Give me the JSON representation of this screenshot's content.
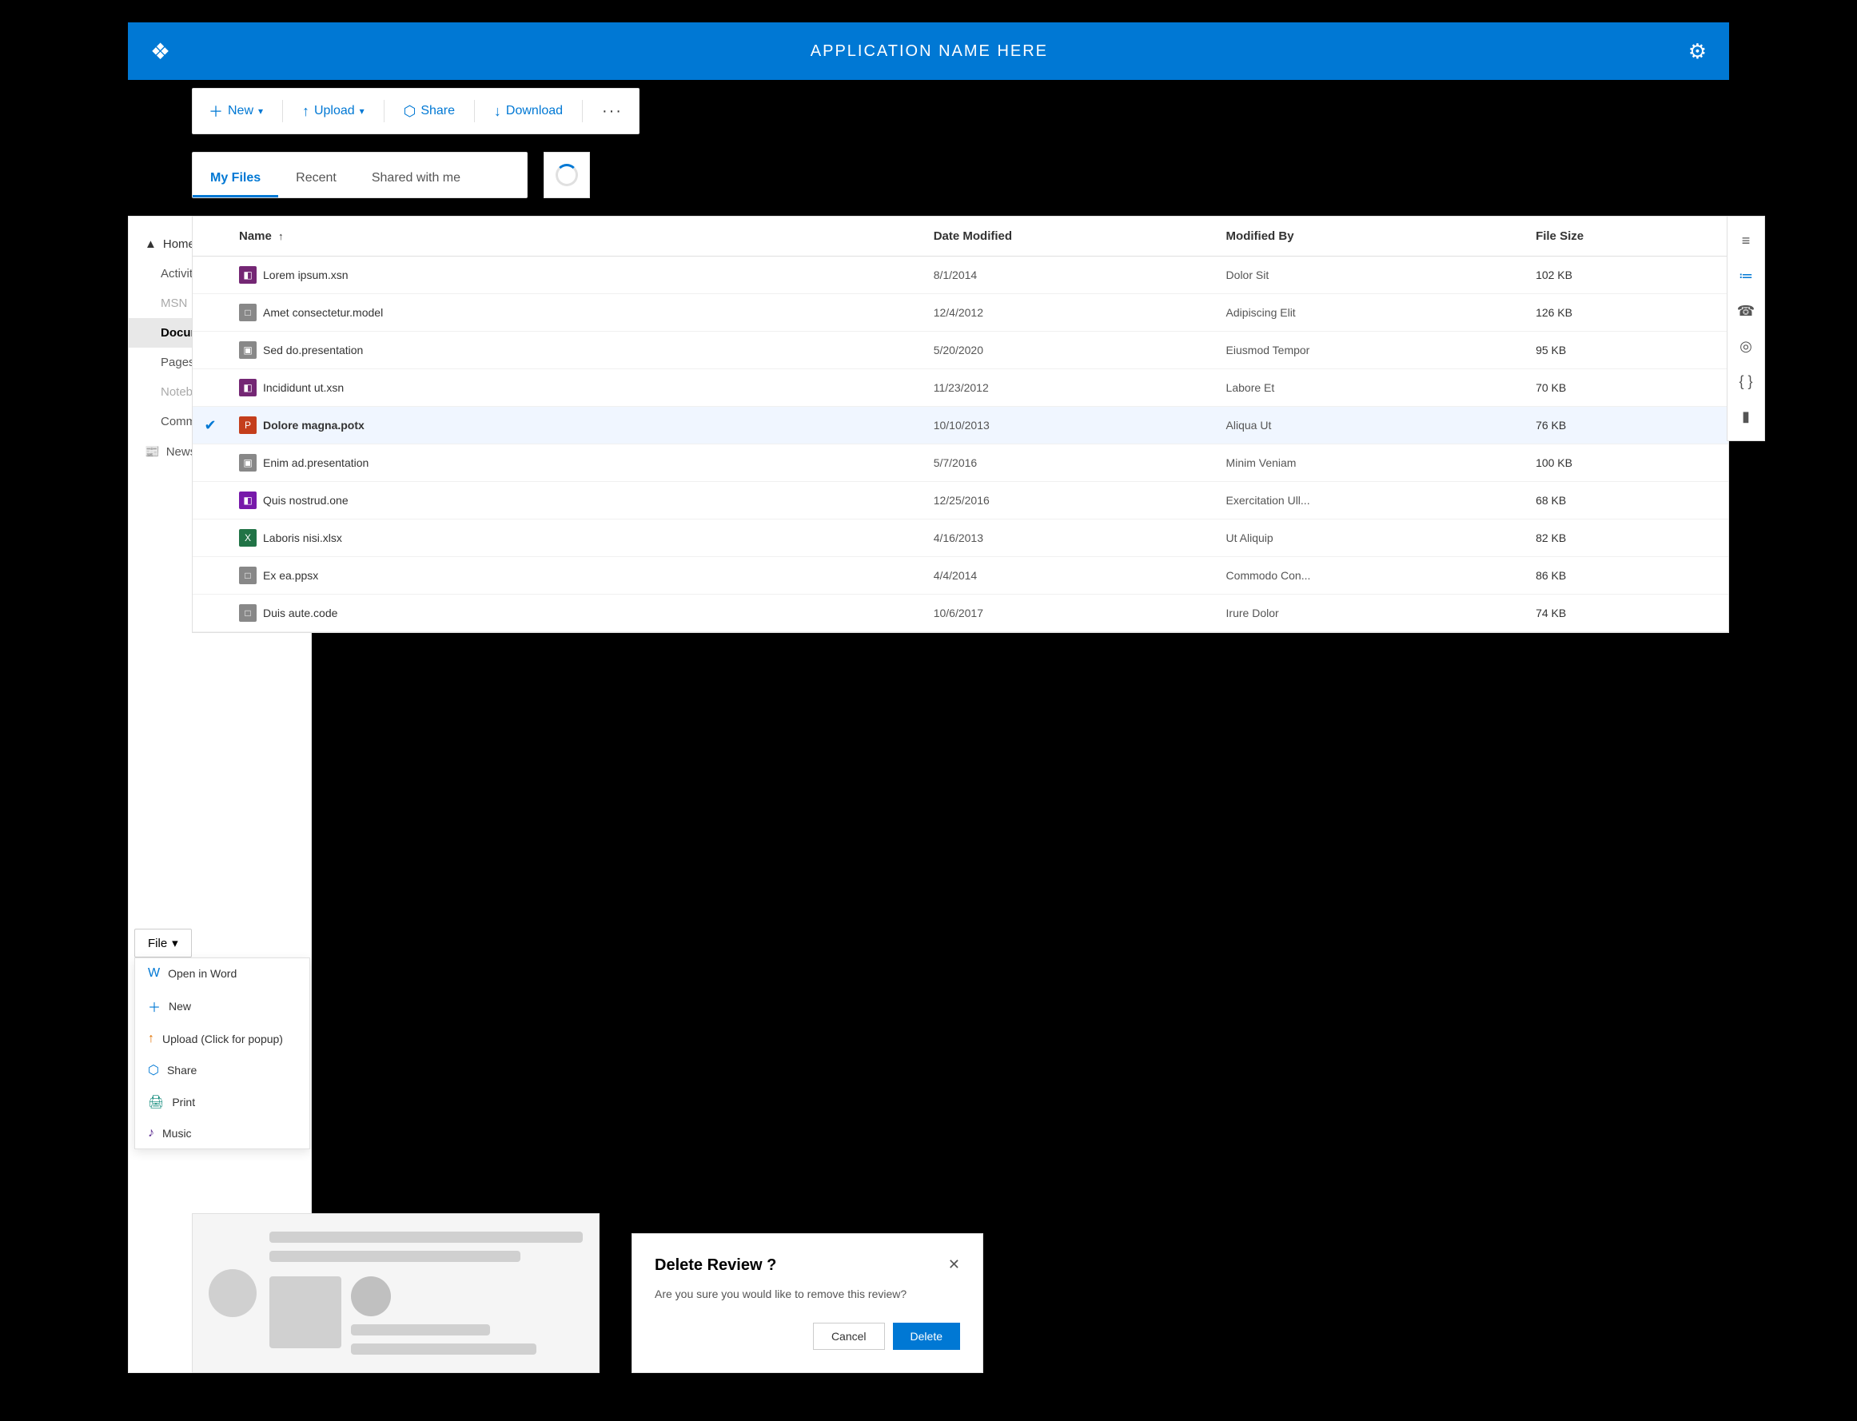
{
  "app": {
    "title": "APPLICATION NAME HERE",
    "logo_icon": "❖",
    "settings_icon": "⚙"
  },
  "toolbar": {
    "new_label": "New",
    "upload_label": "Upload",
    "share_label": "Share",
    "download_label": "Download",
    "more_icon": "···"
  },
  "tabs": {
    "my_files": "My Files",
    "recent": "Recent",
    "shared_with_me": "Shared with me"
  },
  "sidebar": {
    "home_label": "Home",
    "activity_label": "Activity",
    "msn_label": "MSN",
    "documents_label": "Documents",
    "pages_label": "Pages",
    "notebook_label": "Notebook",
    "communication_label": "Communication an...",
    "news_label": "News",
    "news_icon": "📰"
  },
  "file_dropdown": {
    "label": "File",
    "items": [
      {
        "icon": "W",
        "label": "Open in Word",
        "color": "blue"
      },
      {
        "icon": "+",
        "label": "New",
        "color": "blue2"
      },
      {
        "icon": "↑",
        "label": "Upload (Click for popup)",
        "color": "orange"
      },
      {
        "icon": "⬡",
        "label": "Share",
        "color": "blue2"
      },
      {
        "icon": "🖨",
        "label": "Print",
        "color": "teal"
      },
      {
        "icon": "♪",
        "label": "Music",
        "color": "purple"
      }
    ]
  },
  "table": {
    "headers": [
      "",
      "Name ↑",
      "Date Modified",
      "Modified By",
      "File Size"
    ],
    "rows": [
      {
        "icon": "◧",
        "icon_class": "icon-xsn",
        "name": "Lorem ipsum.xsn",
        "date": "8/1/2014",
        "modified_by": "Dolor Sit",
        "file_size": "102 KB",
        "selected": false
      },
      {
        "icon": "□",
        "icon_class": "icon-model",
        "name": "Amet consectetur.model",
        "date": "12/4/2012",
        "modified_by": "Adipiscing Elit",
        "file_size": "126 KB",
        "selected": false
      },
      {
        "icon": "□",
        "icon_class": "icon-pptx-gray",
        "name": "Sed do.presentation",
        "date": "5/20/2020",
        "modified_by": "Eiusmod Tempor",
        "file_size": "95 KB",
        "selected": false
      },
      {
        "icon": "◧",
        "icon_class": "icon-xsn",
        "name": "Incididunt ut.xsn",
        "date": "11/23/2012",
        "modified_by": "Labore Et",
        "file_size": "70 KB",
        "selected": false
      },
      {
        "icon": "P",
        "icon_class": "icon-potx",
        "name": "Dolore magna.potx",
        "date": "10/10/2013",
        "modified_by": "Aliqua Ut",
        "file_size": "76 KB",
        "selected": true
      },
      {
        "icon": "□",
        "icon_class": "icon-pptx-gray",
        "name": "Enim ad.presentation",
        "date": "5/7/2016",
        "modified_by": "Minim Veniam",
        "file_size": "100 KB",
        "selected": false
      },
      {
        "icon": "◧",
        "icon_class": "icon-one",
        "name": "Quis nostrud.one",
        "date": "12/25/2016",
        "modified_by": "Exercitation Ull...",
        "file_size": "68 KB",
        "selected": false
      },
      {
        "icon": "X",
        "icon_class": "icon-xlsx",
        "name": "Laboris nisi.xlsx",
        "date": "4/16/2013",
        "modified_by": "Ut Aliquip",
        "file_size": "82 KB",
        "selected": false
      },
      {
        "icon": "□",
        "icon_class": "icon-ppsx",
        "name": "Ex ea.ppsx",
        "date": "4/4/2014",
        "modified_by": "Commodo Con...",
        "file_size": "86 KB",
        "selected": false
      },
      {
        "icon": "□",
        "icon_class": "icon-code",
        "name": "Duis aute.code",
        "date": "10/6/2017",
        "modified_by": "Irure Dolor",
        "file_size": "74 KB",
        "selected": false
      }
    ]
  },
  "right_sidebar_icons": [
    "≡",
    "≔",
    "☎",
    "◎",
    "{ }",
    "▮"
  ],
  "dialog": {
    "title": "Delete Review ?",
    "body": "Are you sure you would like to remove this review?",
    "cancel_label": "Cancel",
    "delete_label": "Delete",
    "close_icon": "✕"
  }
}
